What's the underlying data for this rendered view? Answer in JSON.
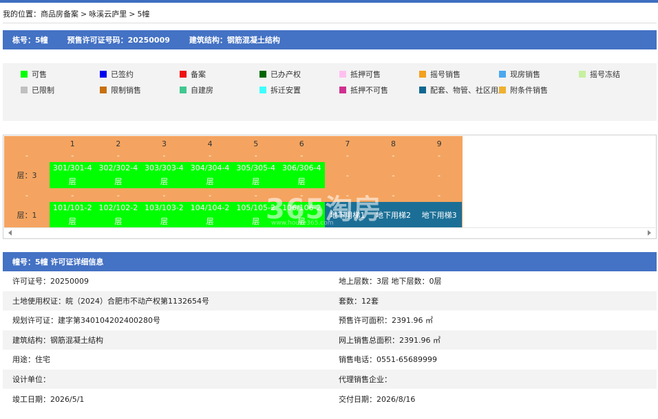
{
  "breadcrumb": {
    "prefix": "我的位置：",
    "items": [
      "商品房备案",
      "咏溪云庐里",
      "5幢"
    ],
    "separator": ">"
  },
  "info_bar": {
    "building": "栋号：5幢",
    "permit": "预售许可证号码：20250009",
    "structure": "建筑结构：钢筋混凝土结构"
  },
  "legend": [
    {
      "label": "可售",
      "color": "#00ff00"
    },
    {
      "label": "已签约",
      "color": "#0000ee"
    },
    {
      "label": "备案",
      "color": "#ee1111"
    },
    {
      "label": "已办产权",
      "color": "#006600"
    },
    {
      "label": "抵押可售",
      "color": "#ffc0f0"
    },
    {
      "label": "摇号销售",
      "color": "#f4a020"
    },
    {
      "label": "现房销售",
      "color": "#4aa8f0"
    },
    {
      "label": "摇号冻结",
      "color": "#c6f0a0"
    },
    {
      "label": "已限制",
      "color": "#c0c0c0"
    },
    {
      "label": "限制销售",
      "color": "#c87010"
    },
    {
      "label": "自建房",
      "color": "#40c890"
    },
    {
      "label": "拆迁安置",
      "color": "#40ffff"
    },
    {
      "label": "抵押不可售",
      "color": "#d03090"
    },
    {
      "label": "配套、物管、社区用房",
      "color": "#106890"
    },
    {
      "label": "附条件销售",
      "color": "#f0b030"
    }
  ],
  "grid": {
    "columns": [
      "1",
      "2",
      "3",
      "4",
      "5",
      "6",
      "7",
      "8",
      "9"
    ],
    "dash": "-",
    "floors": [
      {
        "label": "层：3",
        "units": [
          "301/301-4",
          "302/302-4",
          "303/303-4",
          "304/304-4",
          "305/305-4",
          "306/306-4"
        ],
        "unit_suffix": "层",
        "tail": [
          "-",
          "-",
          "-"
        ]
      },
      {
        "label": "层：1",
        "units": [
          "101/101-2",
          "102/102-2",
          "103/103-2",
          "104/104-2",
          "105/105-2",
          "106/106-2"
        ],
        "unit_suffix": "层",
        "underground": [
          "地下用梯1",
          "地下用梯2",
          "地下用梯3"
        ]
      }
    ]
  },
  "watermark": {
    "main": "365淘房",
    "sub": "www.house365.com"
  },
  "detail": {
    "title": "幢号：5幢 许可证详细信息",
    "rows": [
      {
        "left": "许可证号：20250009",
        "right": "地上层数：3层  地下层数：0层"
      },
      {
        "left": "土地使用权证：皖（2024）合肥市不动产权第1132654号",
        "right": "套数：12套"
      },
      {
        "left": "规划许可证：建字第340104202400280号",
        "right": "预售许可面积：2391.96 ㎡"
      },
      {
        "left": "建筑结构：钢筋混凝土结构",
        "right": "网上销售总面积：2391.96 ㎡"
      },
      {
        "left": "用途：住宅",
        "right": "销售电话：0551-65689999"
      },
      {
        "left": "设计单位：",
        "right": "代理销售企业："
      },
      {
        "left": "竣工日期：2026/5/1",
        "right": "交付日期：2026/8/16"
      }
    ]
  }
}
